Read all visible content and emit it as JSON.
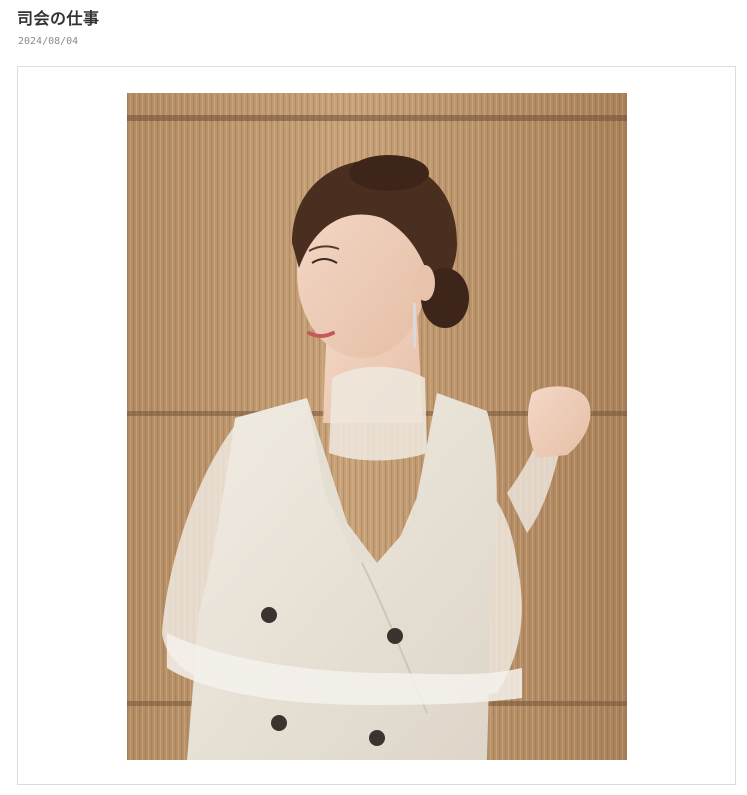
{
  "post": {
    "title": "司会の仕事",
    "date": "2024/08/04"
  },
  "photo": {
    "alt": "司会の仕事"
  }
}
